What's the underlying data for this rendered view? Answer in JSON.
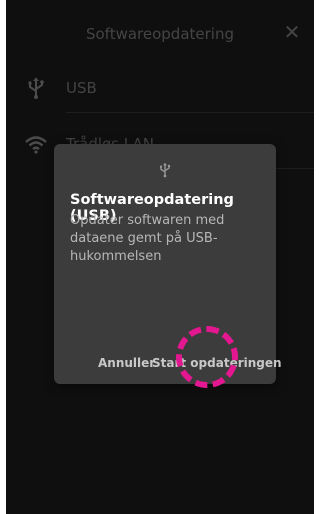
{
  "header": {
    "title": "Softwareopdatering",
    "close_icon": "close-icon"
  },
  "list": {
    "items": [
      {
        "label": "USB",
        "icon": "usb-icon"
      },
      {
        "label": "Trådløs LAN",
        "icon": "wifi-icon"
      }
    ]
  },
  "dialog": {
    "icon": "usb-icon",
    "title": "Softwareopdatering (USB)",
    "message": "Opdater softwaren med dataene gemt på USB-hukommelsen",
    "cancel_label": "Annuller",
    "start_label": "Start opdateringen"
  },
  "colors": {
    "background": "#1c1c1c",
    "dialog": "#3c3c3c",
    "highlight": "#e3178f"
  }
}
